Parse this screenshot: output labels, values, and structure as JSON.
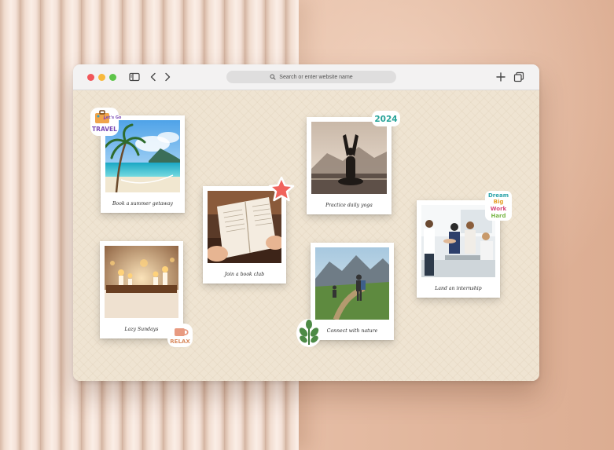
{
  "browser": {
    "address_placeholder": "Search or enter website name"
  },
  "polaroids": [
    {
      "caption": "Book a summer getaway"
    },
    {
      "caption": "Join a book club"
    },
    {
      "caption": "Practice daily yoga"
    },
    {
      "caption": "Lazy Sundays"
    },
    {
      "caption": "Connect with nature"
    },
    {
      "caption": "Land an internship"
    }
  ],
  "stickers": {
    "travel_line1": "Let's Go",
    "travel_line2": "TRAVEL",
    "year": "2024",
    "dream_line1": "Dream",
    "dream_line2": "Big",
    "dream_line3": "Work",
    "dream_line4": "Hard",
    "relax": "RELAX"
  },
  "icons": {
    "traffic_lights": [
      "close",
      "minimize",
      "zoom"
    ],
    "toolbar": [
      "sidebar-icon",
      "back-chevron-icon",
      "forward-chevron-icon",
      "plus-icon",
      "tabs-overview-icon",
      "search-icon"
    ]
  },
  "colors": {
    "close": "#f1565a",
    "minimize": "#f8b93c",
    "zoom": "#5ec54a",
    "canvas_bg": "#efe4d2",
    "wall": "#e6bea6"
  }
}
